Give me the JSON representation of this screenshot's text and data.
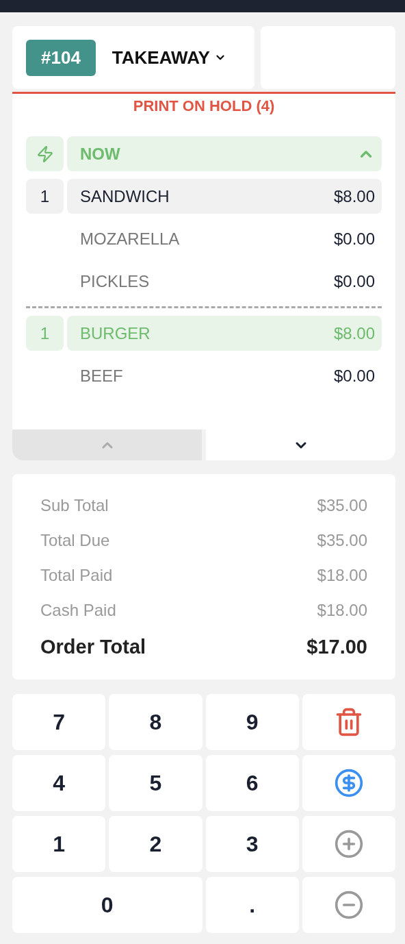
{
  "order": {
    "number": "#104",
    "type": "TAKEAWAY"
  },
  "hold_notice": "PRINT ON HOLD (4)",
  "lines": [
    {
      "kind": "group",
      "label": "NOW",
      "expanded": true
    },
    {
      "kind": "item",
      "qty": "1",
      "name": "SANDWICH",
      "price": "$8.00",
      "selected": false
    },
    {
      "kind": "modifier",
      "name": "MOZARELLA",
      "price": "$0.00"
    },
    {
      "kind": "modifier",
      "name": "PICKLES",
      "price": "$0.00"
    },
    {
      "kind": "divider"
    },
    {
      "kind": "item",
      "qty": "1",
      "name": "BURGER",
      "price": "$8.00",
      "selected": true
    },
    {
      "kind": "modifier",
      "name": "BEEF",
      "price": "$0.00"
    }
  ],
  "scroll": {
    "up_disabled": true,
    "down_disabled": false
  },
  "totals": [
    {
      "label": "Sub Total",
      "value": "$35.00",
      "kind": "minor"
    },
    {
      "label": "Total Due",
      "value": "$35.00",
      "kind": "minor"
    },
    {
      "label": "Total Paid",
      "value": "$18.00",
      "kind": "minor"
    },
    {
      "label": "Cash Paid",
      "value": "$18.00",
      "kind": "minor"
    },
    {
      "label": "Order Total",
      "value": "$17.00",
      "kind": "grand"
    }
  ],
  "keypad": [
    {
      "kind": "digit",
      "label": "7"
    },
    {
      "kind": "digit",
      "label": "8"
    },
    {
      "kind": "digit",
      "label": "9"
    },
    {
      "kind": "delete"
    },
    {
      "kind": "digit",
      "label": "4"
    },
    {
      "kind": "digit",
      "label": "5"
    },
    {
      "kind": "digit",
      "label": "6"
    },
    {
      "kind": "pay"
    },
    {
      "kind": "digit",
      "label": "1"
    },
    {
      "kind": "digit",
      "label": "2"
    },
    {
      "kind": "digit",
      "label": "3"
    },
    {
      "kind": "plus"
    },
    {
      "kind": "wide",
      "label": "0"
    },
    {
      "kind": "digit",
      "label": "."
    },
    {
      "kind": "minus"
    }
  ]
}
